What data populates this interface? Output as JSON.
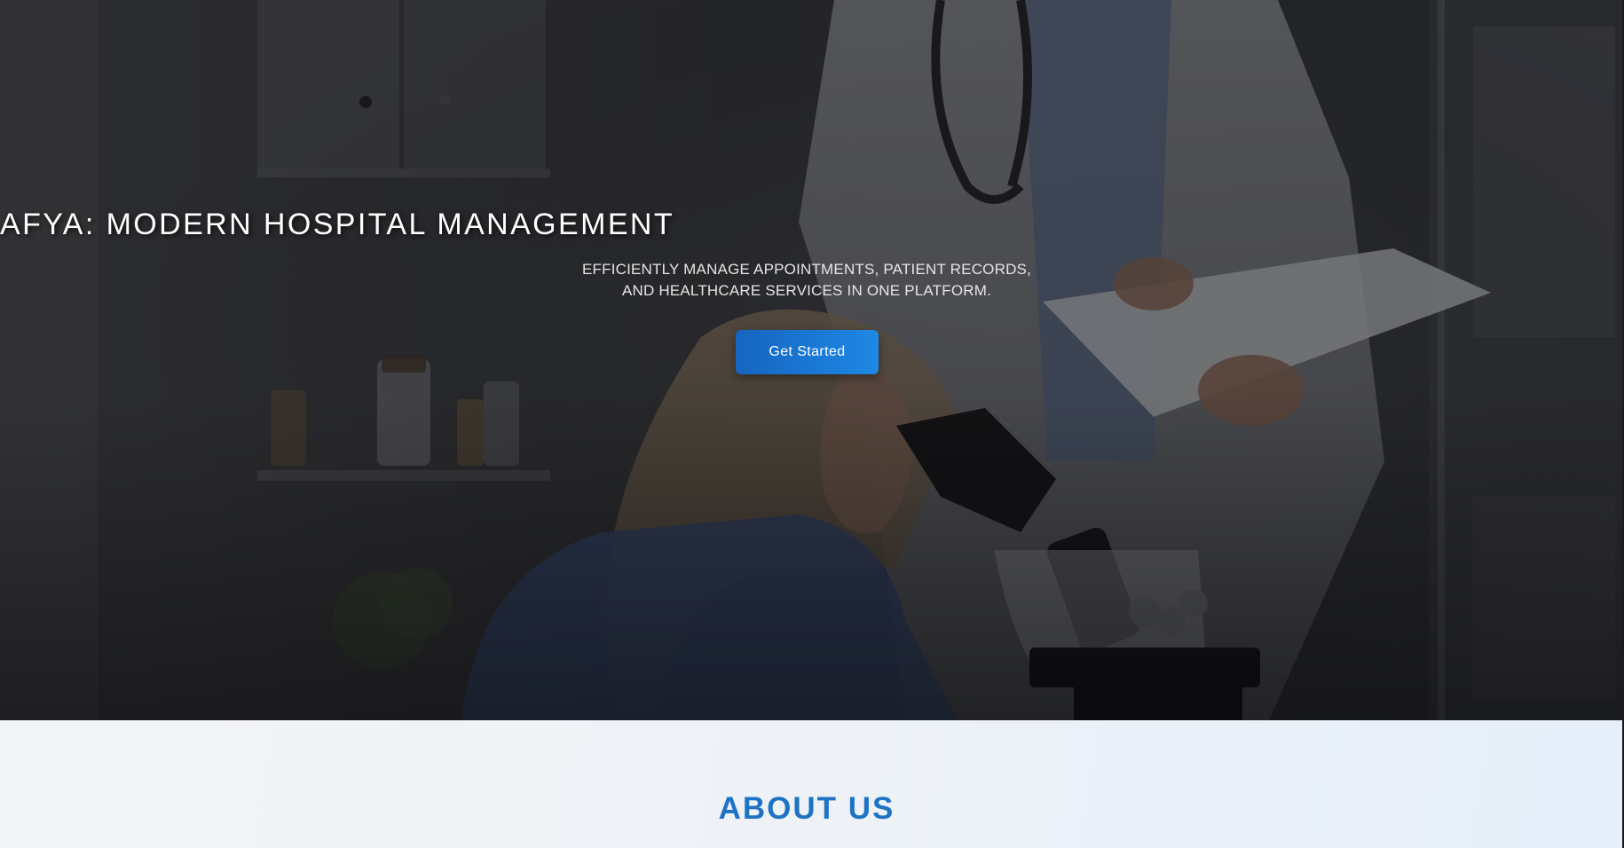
{
  "hero": {
    "title": "AFYA: MODERN HOSPITAL MANAGEMENT",
    "subtitle": "EFFICIENTLY MANAGE APPOINTMENTS, PATIENT RECORDS, AND HEALTHCARE SERVICES IN ONE PLATFORM.",
    "cta_label": "Get Started",
    "background_icon": "lab-photo"
  },
  "about": {
    "title": "ABOUT US"
  },
  "colors": {
    "accent": "#1e73c4",
    "button_start": "#1565c0",
    "button_end": "#1e88e5",
    "section_bg": "#eef2f7"
  }
}
